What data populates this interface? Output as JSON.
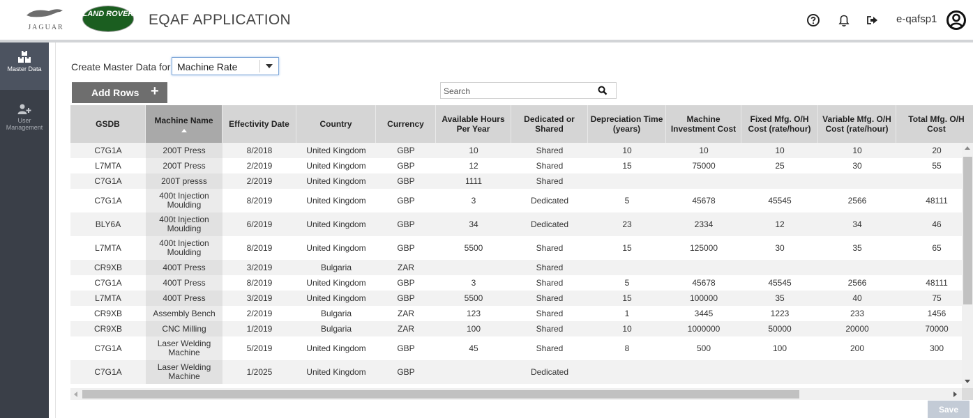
{
  "header": {
    "brand_jaguar": "JAGUAR",
    "brand_landrover": "LAND ROVER",
    "title": "EQAF APPLICATION",
    "user": "e-qafsp1"
  },
  "sidebar": {
    "items": [
      {
        "label": "Master Data",
        "icon": "master-data-icon",
        "active": true
      },
      {
        "label": "User Management",
        "icon": "add-user-icon",
        "active": false
      }
    ]
  },
  "toolbar": {
    "create_label": "Create Master Data for",
    "selected_type": "Machine Rate",
    "add_rows_label": "Add Rows",
    "search_placeholder": "Search",
    "save_label": "Save"
  },
  "table": {
    "sorted_column": "Machine Name",
    "columns": [
      "GSDB",
      "Machine Name",
      "Effectivity Date",
      "Country",
      "Currency",
      "Available Hours Per Year",
      "Dedicated or Shared",
      "Depreciation Time (years)",
      "Machine Investment Cost",
      "Fixed Mfg. O/H Cost (rate/hour)",
      "Variable Mfg. O/H Cost (rate/hour)",
      "Total Mfg. O/H Cost"
    ],
    "rows": [
      [
        "C7G1A",
        "200T Press",
        "8/2018",
        "United Kingdom",
        "GBP",
        "10",
        "Shared",
        "10",
        "10",
        "10",
        "10",
        "20"
      ],
      [
        "L7MTA",
        "200T Press",
        "2/2019",
        "United Kingdom",
        "GBP",
        "12",
        "Shared",
        "15",
        "75000",
        "25",
        "30",
        "55"
      ],
      [
        "C7G1A",
        "200T presss",
        "2/2019",
        "United Kingdom",
        "GBP",
        "1111",
        "Shared",
        "",
        "",
        "",
        "",
        ""
      ],
      [
        "C7G1A",
        "400t Injection Moulding",
        "8/2019",
        "United Kingdom",
        "GBP",
        "3",
        "Dedicated",
        "5",
        "45678",
        "45545",
        "2566",
        "48111"
      ],
      [
        "BLY6A",
        "400t Injection Moulding",
        "6/2019",
        "United Kingdom",
        "GBP",
        "34",
        "Dedicated",
        "23",
        "2334",
        "12",
        "34",
        "46"
      ],
      [
        "L7MTA",
        "400t Injection Moulding",
        "8/2019",
        "United Kingdom",
        "GBP",
        "5500",
        "Shared",
        "15",
        "125000",
        "30",
        "35",
        "65"
      ],
      [
        "CR9XB",
        "400T Press",
        "3/2019",
        "Bulgaria",
        "ZAR",
        "",
        "Shared",
        "",
        "",
        "",
        "",
        ""
      ],
      [
        "C7G1A",
        "400T Press",
        "8/2019",
        "United Kingdom",
        "GBP",
        "3",
        "Shared",
        "5",
        "45678",
        "45545",
        "2566",
        "48111"
      ],
      [
        "L7MTA",
        "400T Press",
        "3/2019",
        "United Kingdom",
        "GBP",
        "5500",
        "Shared",
        "15",
        "100000",
        "35",
        "40",
        "75"
      ],
      [
        "CR9XB",
        "Assembly Bench",
        "2/2019",
        "Bulgaria",
        "ZAR",
        "123",
        "Shared",
        "1",
        "3445",
        "1223",
        "233",
        "1456"
      ],
      [
        "CR9XB",
        "CNC Milling",
        "1/2019",
        "Bulgaria",
        "ZAR",
        "100",
        "Shared",
        "10",
        "1000000",
        "50000",
        "20000",
        "70000"
      ],
      [
        "C7G1A",
        "Laser Welding Machine",
        "5/2019",
        "United Kingdom",
        "GBP",
        "45",
        "Shared",
        "8",
        "500",
        "100",
        "200",
        "300"
      ],
      [
        "C7G1A",
        "Laser Welding Machine",
        "1/2025",
        "United Kingdom",
        "GBP",
        "",
        "Dedicated",
        "",
        "",
        "",
        "",
        ""
      ]
    ]
  }
}
